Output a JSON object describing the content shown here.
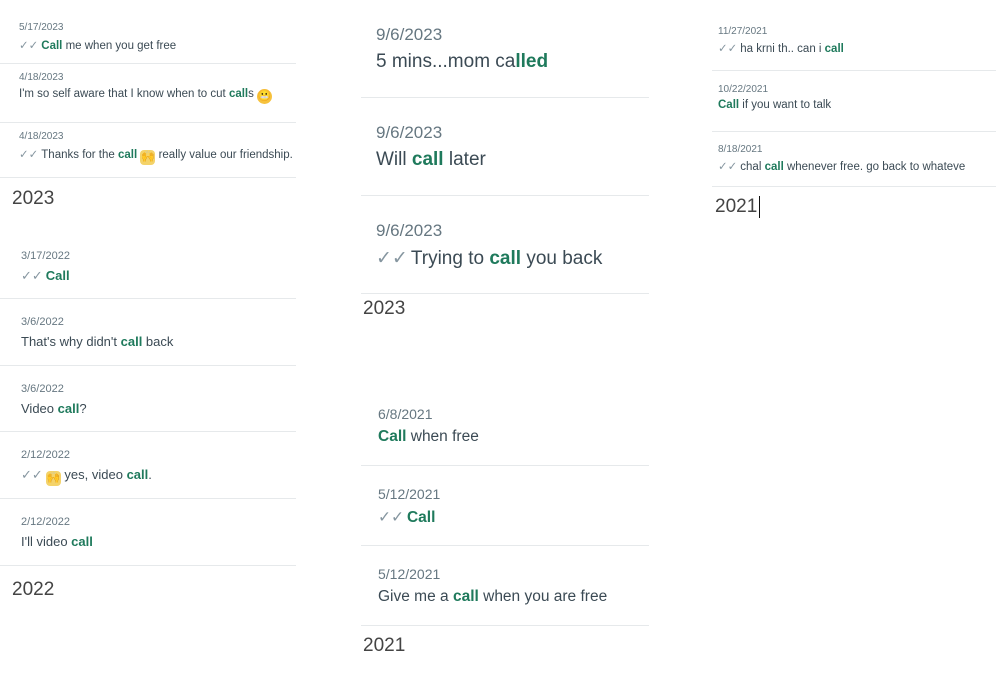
{
  "columns": [
    {
      "id": "col1",
      "groups": [
        {
          "entries": [
            {
              "date": "5/17/2023",
              "ticked": true,
              "parts": [
                [
                  "Call",
                  true
                ],
                [
                  " me when you get free",
                  false
                ]
              ]
            },
            {
              "date": "4/18/2023",
              "ticked": false,
              "parts": [
                [
                  "I'm so self aware that I know when to cut ",
                  false
                ],
                [
                  "call",
                  true
                ],
                [
                  "s ",
                  false
                ]
              ],
              "emoji_after": "face"
            },
            {
              "date": "4/18/2023",
              "ticked": true,
              "parts": [
                [
                  "Thanks for the ",
                  false
                ],
                [
                  "call",
                  true
                ],
                [
                  " ",
                  false
                ]
              ],
              "emoji_mid": "hands",
              "parts_after": [
                [
                  " really value our friendship.",
                  false
                ]
              ]
            }
          ],
          "year": "2023"
        },
        {
          "entries": [
            {
              "date": "3/17/2022",
              "ticked": true,
              "parts": [
                [
                  "Call",
                  true
                ]
              ]
            },
            {
              "date": "3/6/2022",
              "ticked": false,
              "parts": [
                [
                  "That's why didn't ",
                  false
                ],
                [
                  "call",
                  true
                ],
                [
                  " back",
                  false
                ]
              ]
            },
            {
              "date": "3/6/2022",
              "ticked": false,
              "parts": [
                [
                  "Video ",
                  false
                ],
                [
                  "call",
                  true
                ],
                [
                  "?",
                  false
                ]
              ]
            },
            {
              "date": "2/12/2022",
              "ticked": true,
              "parts": [],
              "emoji_mid": "hands",
              "parts_after": [
                [
                  " yes, video ",
                  false
                ],
                [
                  "call",
                  true
                ],
                [
                  ".",
                  false
                ]
              ]
            },
            {
              "date": "2/12/2022",
              "ticked": false,
              "parts": [
                [
                  "I'll video ",
                  false
                ],
                [
                  "call",
                  true
                ]
              ]
            }
          ],
          "year": "2022"
        }
      ]
    },
    {
      "id": "col2",
      "groups": [
        {
          "entries": [
            {
              "date": "9/6/2023",
              "ticked": false,
              "parts": [
                [
                  "5 mins...mom ca",
                  false
                ],
                [
                  "lled",
                  true
                ]
              ]
            },
            {
              "date": "9/6/2023",
              "ticked": false,
              "parts": [
                [
                  "Will ",
                  false
                ],
                [
                  "call",
                  true
                ],
                [
                  " later",
                  false
                ]
              ]
            },
            {
              "date": "9/6/2023",
              "ticked": true,
              "parts": [
                [
                  "Trying to ",
                  false
                ],
                [
                  "call",
                  true
                ],
                [
                  " you back",
                  false
                ]
              ]
            }
          ],
          "year": "2023"
        },
        {
          "entries": [
            {
              "date": "6/8/2021",
              "ticked": false,
              "parts": [
                [
                  "Call",
                  true
                ],
                [
                  " when free",
                  false
                ]
              ]
            },
            {
              "date": "5/12/2021",
              "ticked": true,
              "parts": [
                [
                  "Call",
                  true
                ]
              ]
            },
            {
              "date": "5/12/2021",
              "ticked": false,
              "parts": [
                [
                  "Give me a ",
                  false
                ],
                [
                  "call",
                  true
                ],
                [
                  " when you are free",
                  false
                ]
              ]
            }
          ],
          "year": "2021"
        }
      ]
    },
    {
      "id": "col3",
      "groups": [
        {
          "entries": [
            {
              "date": "11/27/2021",
              "ticked": true,
              "parts": [
                [
                  "ha krni th.. can i ",
                  false
                ],
                [
                  "call",
                  true
                ]
              ]
            },
            {
              "date": "10/22/2021",
              "ticked": false,
              "parts": [
                [
                  "Call",
                  true
                ],
                [
                  " if you want to talk",
                  false
                ]
              ]
            },
            {
              "date": "8/18/2021",
              "ticked": true,
              "parts": [
                [
                  "chal ",
                  false
                ],
                [
                  "call",
                  true
                ],
                [
                  " whenever free. go back to whateve",
                  false
                ]
              ]
            }
          ],
          "year": "2021"
        }
      ]
    }
  ],
  "tick_glyph": "✓✓",
  "colors": {
    "highlight": "#1f7a5c",
    "text": "#3b4a54",
    "date": "#667781",
    "divider": "#e6e9eb"
  }
}
